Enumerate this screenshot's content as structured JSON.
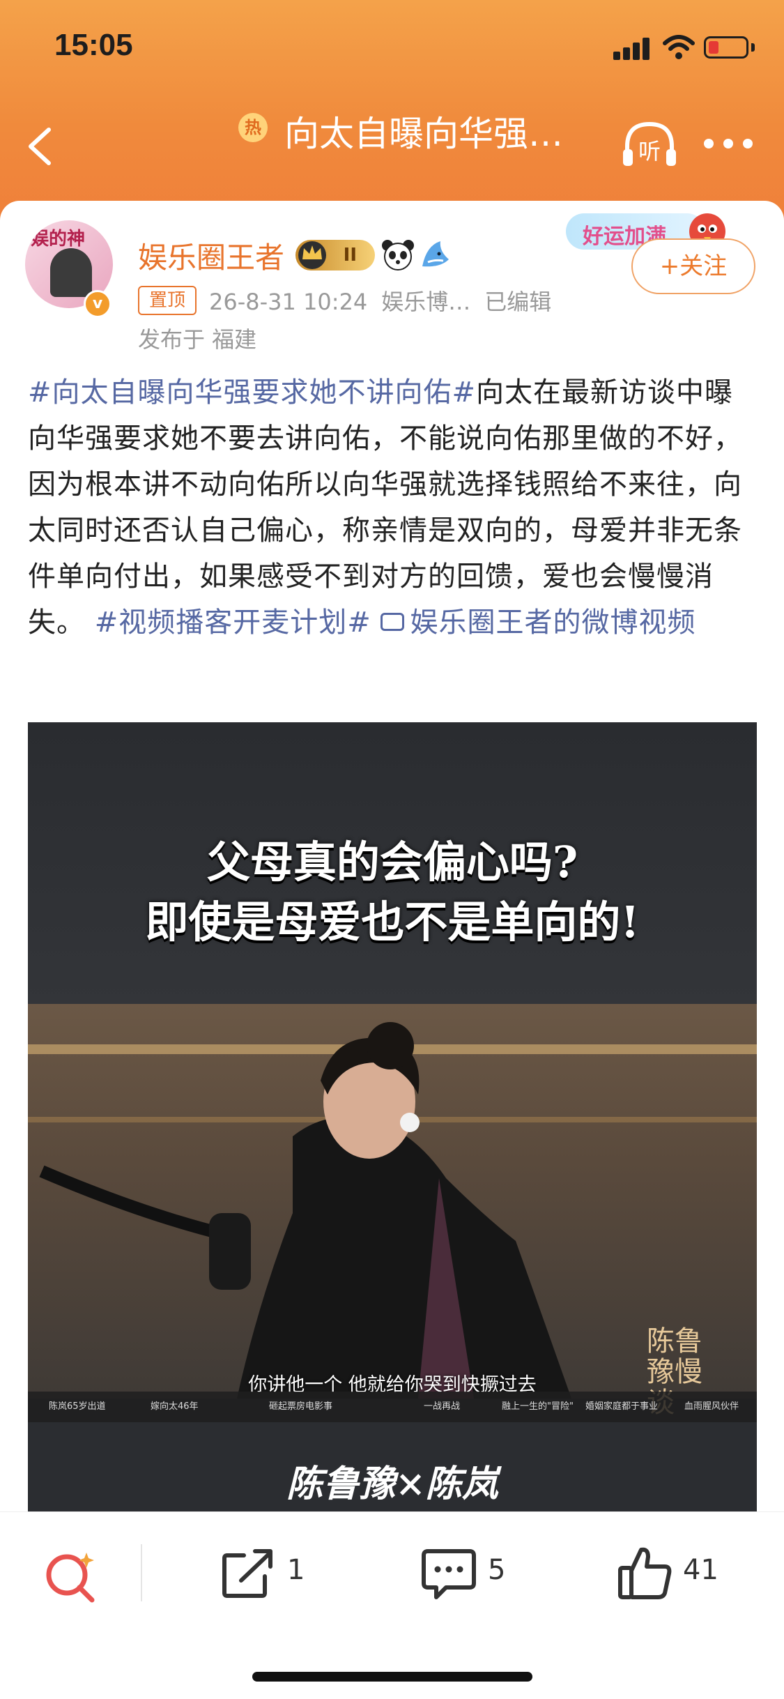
{
  "status_bar": {
    "time": "15:05"
  },
  "nav": {
    "hot_label": "热",
    "title": "向太自曝向华强…",
    "listen_label": "听"
  },
  "author": {
    "name": "娱乐圈王者",
    "vip_level": "II",
    "avatar_text": "娱的神",
    "lucky_badge": "好运加满",
    "follow_label": "+关注"
  },
  "post_meta": {
    "pin_label": "置顶",
    "date": "26-8-31 10:24",
    "source": "娱乐博…",
    "edited": "已编辑",
    "location": "发布于 福建"
  },
  "post": {
    "topic1": "#向太自曝向华强要求她不讲向佑#",
    "body": "向太在最新访谈中曝向华强要求她不要去讲向佑，不能说向佑那里做的不好，因为根本讲不动向佑所以向华强就选择钱照给不来往，向太同时还否认自己偏心，称亲情是双向的，母爱并非无条件单向付出，如果感受不到对方的回馈，爱也会慢慢消失。",
    "topic2": "#视频播客开麦计划#",
    "video_link": "娱乐圈王者的微博视频"
  },
  "video": {
    "headline1": "父母真的会偏心吗?",
    "headline2": "即使是母爱也不是单向的!",
    "subtitle": "你讲他一个 他就给你哭到快撅过去",
    "ticker": [
      "陈岚65岁出道",
      "嫁向太46年",
      "砸起票房电影事",
      "一战再战",
      "融上一生的\"冒险\"",
      "婚姻家庭都于事业",
      "血雨腥风伙伴"
    ],
    "watermark": "陈鲁豫慢谈",
    "names": "陈鲁豫×陈岚"
  },
  "actions": {
    "repost_count": "1",
    "comment_count": "5",
    "like_count": "41"
  },
  "colors": {
    "header_orange": "#f08a3c",
    "topic_blue": "#5668a3",
    "author_orange": "#e8742c"
  }
}
